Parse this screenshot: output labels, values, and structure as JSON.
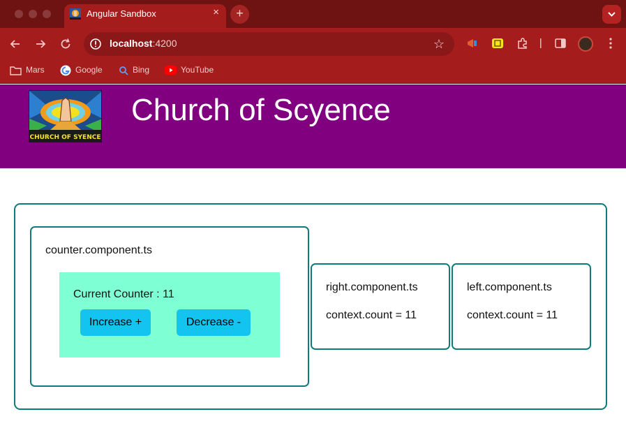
{
  "browser": {
    "tab_title": "Angular Sandbox",
    "tab_close": "×",
    "new_tab": "+",
    "url_host": "localhost",
    "url_port": ":4200",
    "accent": "#a51c1c",
    "bookmarks": [
      {
        "label": "Mars",
        "icon": "folder-icon"
      },
      {
        "label": "Google",
        "icon": "google-icon"
      },
      {
        "label": "Bing",
        "icon": "bing-icon"
      },
      {
        "label": "YouTube",
        "icon": "youtube-icon"
      }
    ]
  },
  "header": {
    "title": "Church of Scyence",
    "logo_caption": "CHURCH OF SYENCE",
    "background": "#800080"
  },
  "counter": {
    "file_label": "counter.component.ts",
    "current_label": "Current Counter : 11",
    "increase_label": "Increase +",
    "decrease_label": "Decrease -"
  },
  "right_panel": {
    "file_label": "right.component.ts",
    "count_label": "context.count = 11"
  },
  "left_panel": {
    "file_label": "left.component.ts",
    "count_label": "context.count = 11"
  }
}
